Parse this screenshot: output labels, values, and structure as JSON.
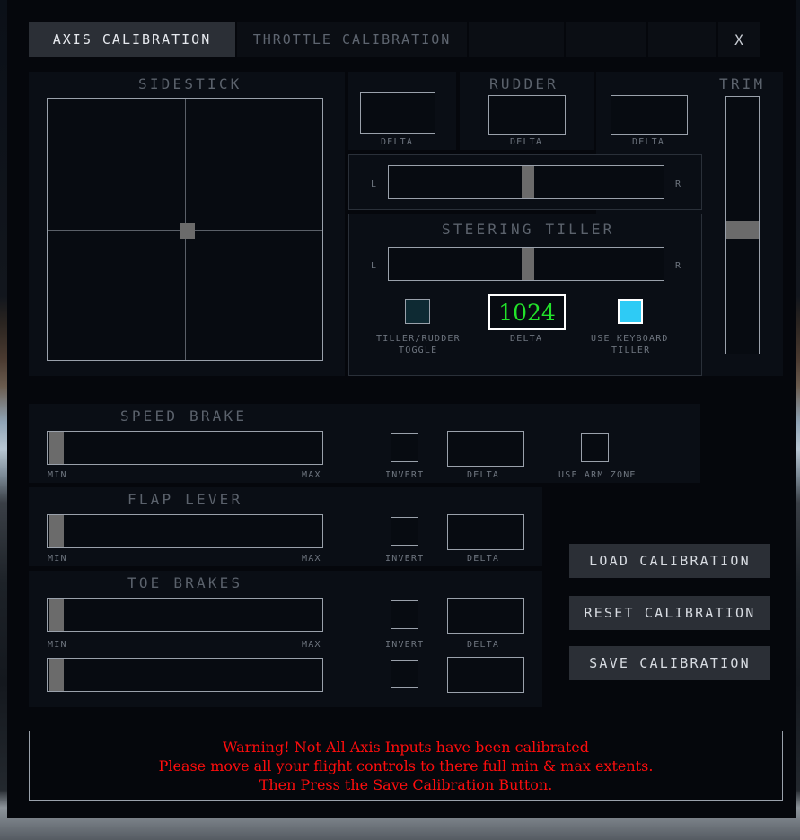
{
  "window": {
    "tabs": [
      {
        "label": "AXIS CALIBRATION",
        "active": true
      },
      {
        "label": "THROTTLE CALIBRATION",
        "active": false
      },
      {
        "label": "",
        "active": false
      },
      {
        "label": "",
        "active": false
      },
      {
        "label": "",
        "active": false
      }
    ],
    "close_label": "X"
  },
  "sidestick": {
    "title": "SIDESTICK",
    "delta_label": "DELTA",
    "delta_value": ""
  },
  "rudder": {
    "title": "RUDDER",
    "delta_label": "DELTA",
    "delta_value": "",
    "left_label": "L",
    "right_label": "R"
  },
  "trim": {
    "title": "TRIM",
    "delta_label": "DELTA",
    "delta_value": ""
  },
  "tiller": {
    "title": "STEERING TILLER",
    "left_label": "L",
    "right_label": "R",
    "toggle_label_line1": "TILLER/RUDDER",
    "toggle_label_line2": "TOGGLE",
    "delta_label": "DELTA",
    "delta_value": "1024",
    "keyboard_label_line1": "USE KEYBOARD",
    "keyboard_label_line2": "TILLER"
  },
  "speed_brake": {
    "title": "SPEED BRAKE",
    "min_label": "MIN",
    "max_label": "MAX",
    "invert_label": "INVERT",
    "delta_label": "DELTA",
    "delta_value": "",
    "arm_zone_label": "USE ARM ZONE"
  },
  "flap_lever": {
    "title": "FLAP LEVER",
    "min_label": "MIN",
    "max_label": "MAX",
    "invert_label": "INVERT",
    "delta_label": "DELTA",
    "delta_value": ""
  },
  "toe_brakes": {
    "title": "TOE BRAKES",
    "min_label": "MIN",
    "max_label": "MAX",
    "invert_label": "INVERT",
    "delta_label": "DELTA",
    "delta_value_left": "",
    "delta_value_right": ""
  },
  "actions": {
    "load": "LOAD CALIBRATION",
    "reset": "RESET CALIBRATION",
    "save": "SAVE CALIBRATION"
  },
  "warning": {
    "line1": "Warning!  Not All Axis Inputs have been calibrated",
    "line2": "Please move all your flight controls to there full min & max extents.",
    "line3": "Then Press the Save Calibration Button."
  },
  "colors": {
    "accent_green": "#22e22a",
    "accent_cyan": "#2ecbf5",
    "warning_red": "#ff0d0d",
    "panel_bg": "#0a0e15",
    "window_bg": "#05070c",
    "outline": "#9aa1ab"
  }
}
